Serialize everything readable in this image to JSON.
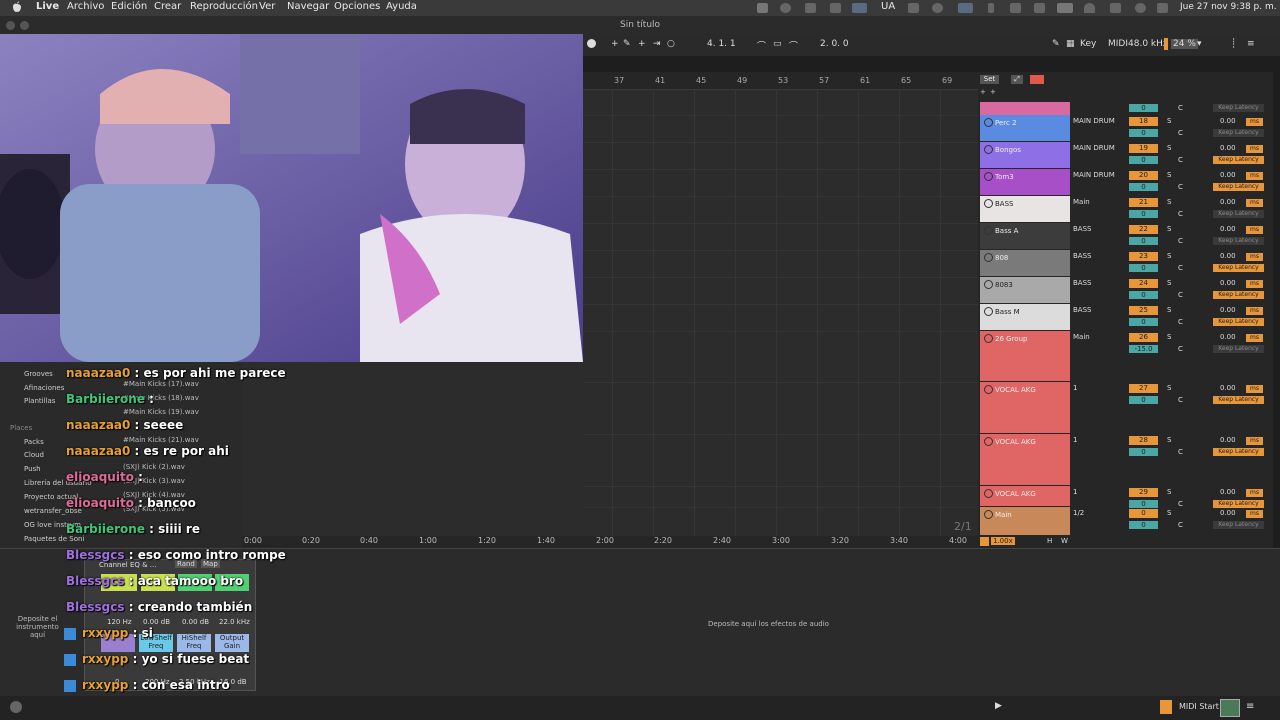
{
  "menubar": {
    "app": "Live",
    "items": [
      "Archivo",
      "Edición",
      "Crear",
      "Reproducción",
      "Ver",
      "Navegar",
      "Opciones",
      "Ayuda"
    ],
    "lang": "UA",
    "clock": "Jue 27 nov  9:38 p. m."
  },
  "window": {
    "title": "Sin título"
  },
  "control": {
    "position": "4.  1.  1",
    "loop_length": "2.  0.  0",
    "key": "Key",
    "midi": "MIDI",
    "sample_rate": "48.0 kHz",
    "cpu": "24 %"
  },
  "ruler": {
    "bars": [
      "37",
      "41",
      "45",
      "49",
      "53",
      "57",
      "61",
      "65",
      "69"
    ]
  },
  "mixer": {
    "set_label": "Set",
    "tracks": [
      {
        "name": "Perc 2",
        "color": "#5a8be0",
        "io": "MAIN DRUM",
        "num": "18",
        "send": "0",
        "vol": "0.00",
        "kl_on": false
      },
      {
        "name": "Bongos",
        "color": "#8e6fe6",
        "io": "MAIN DRUM",
        "num": "19",
        "send": "0",
        "vol": "0.00",
        "kl_on": true
      },
      {
        "name": "Tom3",
        "color": "#a64fc6",
        "io": "MAIN DRUM",
        "num": "20",
        "send": "0",
        "vol": "0.00",
        "kl_on": true
      },
      {
        "name": "BASS",
        "color": "#e8e4e4",
        "io": "Main",
        "num": "21",
        "send": "0",
        "vol": "0.00",
        "kl_on": false
      },
      {
        "name": "Bass A",
        "color": "#3c3c3c",
        "io": "BASS",
        "num": "22",
        "send": "0",
        "vol": "0.00",
        "kl_on": false
      },
      {
        "name": "808",
        "color": "#7a7a7a",
        "io": "BASS",
        "num": "23",
        "send": "0",
        "vol": "0.00",
        "kl_on": true
      },
      {
        "name": "8083",
        "color": "#a9a9a9",
        "io": "BASS",
        "num": "24",
        "send": "0",
        "vol": "0.00",
        "kl_on": true
      },
      {
        "name": "Bass M",
        "color": "#dcdcdc",
        "io": "BASS",
        "num": "25",
        "send": "0",
        "vol": "0.00",
        "kl_on": true
      },
      {
        "name": "26 Group",
        "color": "#e06565",
        "io": "Main",
        "num": "26",
        "send": "-15.0",
        "vol": "0.00",
        "kl_on": false
      },
      {
        "name": "VOCAL AKG",
        "color": "#e06565",
        "io": "1",
        "num": "27",
        "send": "0",
        "vol": "0.00",
        "kl_on": true
      },
      {
        "name": "VOCAL AKG",
        "color": "#e06565",
        "io": "1",
        "num": "28",
        "send": "0",
        "vol": "0.00",
        "kl_on": true
      },
      {
        "name": "VOCAL AKG",
        "color": "#e06565",
        "io": "1",
        "num": "29",
        "send": "0",
        "vol": "0.00",
        "kl_on": true
      },
      {
        "name": "Main",
        "color": "#c8885a",
        "io": "1/2",
        "num": "0",
        "send": "0",
        "vol": "0.00",
        "kl_on": false
      }
    ],
    "in_label": "In",
    "auto_label": "Auto",
    "off_label": "Off",
    "group_io": "26-Group",
    "minus_inf": "-∞",
    "neg10": "-10.0",
    "keep_latency": "Keep Latency",
    "page": "2/1",
    "zoom": "1.00x",
    "h": "H",
    "w": "W"
  },
  "timeline": [
    "0:00",
    "0:20",
    "0:40",
    "1:00",
    "1:20",
    "1:40",
    "2:00",
    "2:20",
    "2:40",
    "3:00",
    "3:20",
    "3:40",
    "4:00"
  ],
  "browser": {
    "categories": [
      "Grooves",
      "Afinaciones",
      "Plantillas"
    ],
    "places_label": "Places",
    "places": [
      "Packs",
      "Cloud",
      "Push",
      "Librería del usuario",
      "Proyecto actual",
      "wetransfer_obse",
      "OG love instrum",
      "Paquetes de Soni"
    ],
    "files": [
      "#Main Kicks (17).wav",
      "#Main Kicks (18).wav",
      "#Main Kicks (19).wav",
      "#Main Kicks (21).wav",
      "(SXJ) Kick (2).wav",
      "(SXJ) Kick (3).wav",
      "(SXJ) Kick (4).wav",
      "(SXJ) Kick (5).wav"
    ]
  },
  "chat": [
    {
      "user": "naaazaa0",
      "msg": "es por ahi me parece",
      "color": "#e8a030"
    },
    {
      "user": "Barbiierone",
      "msg": "",
      "color": "#3fc87a"
    },
    {
      "user": "naaazaa0",
      "msg": "seeee",
      "color": "#e8a030"
    },
    {
      "user": "naaazaa0",
      "msg": "es re por ahi",
      "color": "#e8a030"
    },
    {
      "user": "elioaquito",
      "msg": "",
      "color": "#e06a9a"
    },
    {
      "user": "elioaquito",
      "msg": "bancoo",
      "color": "#e06a9a"
    },
    {
      "user": "Barbiierone",
      "msg": "siiii re",
      "color": "#3fc87a"
    },
    {
      "user": "Blessgcs",
      "msg": "eso como intro rompe",
      "color": "#a070e0"
    },
    {
      "user": "Blessgcs",
      "msg": "aca tamooo bro",
      "color": "#a070e0"
    },
    {
      "user": "Blessgcs",
      "msg": "creando también",
      "color": "#a070e0"
    },
    {
      "user": "rxxypp",
      "msg": "si",
      "color": "#e8a030"
    },
    {
      "user": "rxxypp",
      "msg": "yo si fuese beat",
      "color": "#e8a030"
    },
    {
      "user": "rxxypp",
      "msg": "con esa intro",
      "color": "#e8a030"
    }
  ],
  "device": {
    "drop_instrument": "Deposite el instrumento aquí",
    "drop_effects": "Deposite aquí los efectos de audio",
    "eq_title": "Channel EQ & ...",
    "rand": "Rand",
    "map": "Map",
    "freq1": "120 Hz",
    "gain1": "0.00 dB",
    "gain2": "0.00 dB",
    "freq2": "22.0 kHz",
    "lowshelf": "LowShelf Freq",
    "hishelf": "HiShelf Freq",
    "output": "Output Gain",
    "v1": "0",
    "v2": "200 Hz",
    "v3": "2.50 kHz",
    "v4": "-16.0 dB"
  },
  "status": {
    "midi_start": "MIDI Start"
  }
}
